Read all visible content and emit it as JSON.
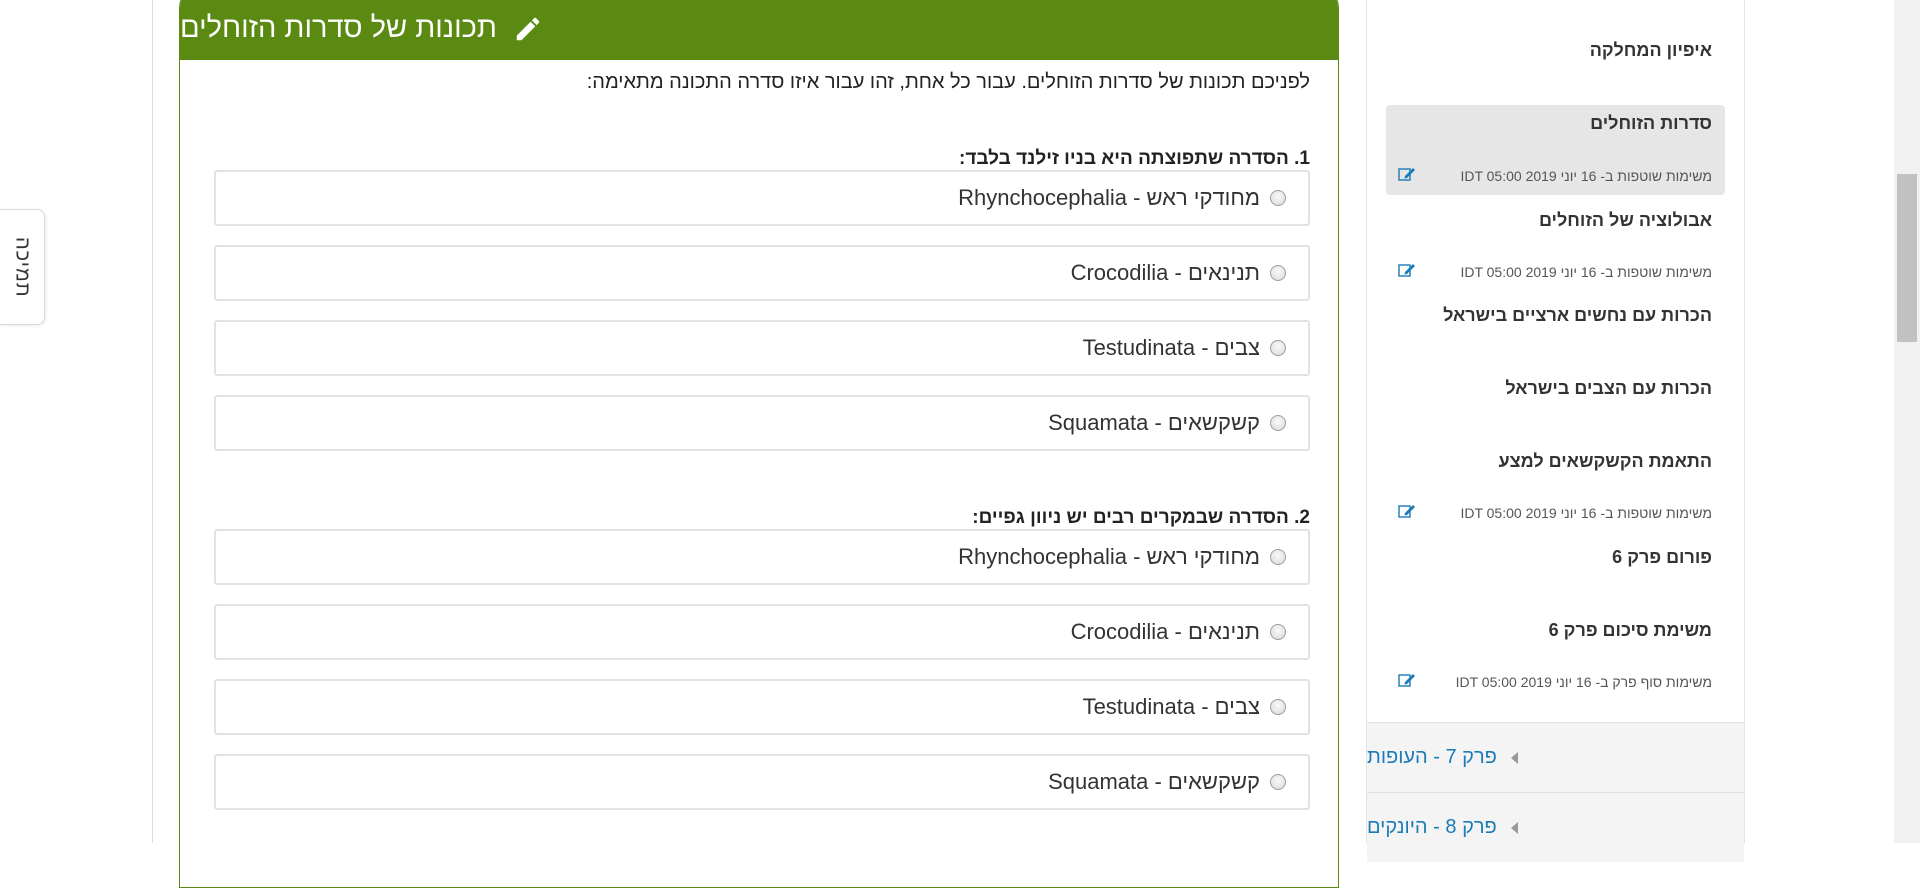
{
  "support_tab": {
    "label": "תמיכה"
  },
  "card": {
    "title": "תכונות של סדרות הזוחלים",
    "header_color": "#5b8a12",
    "intro": "לפניכם תכונות של סדרות הזוחלים. עבור כל אחת, זהו עבור איזו סדרה התכונה מתאימה:",
    "questions": [
      {
        "title": "1. הסדרה שתפוצתה היא בניו זילנד בלבד:",
        "options": [
          "מחודקי ראש - Rhynchocephalia",
          "תנינאים - Crocodilia",
          "צבים - Testudinata",
          "קשקשאים - Squamata"
        ]
      },
      {
        "title": "2. הסדרה שבמקרים רבים יש ניוון גפיים:",
        "options": [
          "מחודקי ראש - Rhynchocephalia",
          "תנינאים - Crocodilia",
          "צבים - Testudinata",
          "קשקשאים - Squamata"
        ]
      }
    ]
  },
  "sidebar": {
    "items": [
      {
        "title": "איפיון המחלקה",
        "meta": ""
      },
      {
        "title": "סדרות הזוחלים",
        "meta": "משימות שוטפות ב- 16 יוני 2019 IDT 05:00",
        "active": true
      },
      {
        "title": "אבולוציה של הזוחלים",
        "meta": "משימות שוטפות ב- 16 יוני 2019 IDT 05:00"
      },
      {
        "title": "הכרות עם נחשים ארציים בישראל",
        "meta": ""
      },
      {
        "title": "הכרות עם הצבים בישראל",
        "meta": ""
      },
      {
        "title": "התאמת הקשקשאים למצע",
        "meta": "משימות שוטפות ב- 16 יוני 2019 IDT 05:00"
      },
      {
        "title": "פורום פרק 6",
        "meta": ""
      },
      {
        "title": "משימת סיכום פרק 6",
        "meta": "משימות סוף פרק ב- 16 יוני 2019 IDT 05:00"
      }
    ],
    "sections": [
      {
        "label": "פרק 7 - העופות"
      },
      {
        "label": "פרק 8 - היונקים"
      }
    ],
    "link_color": "#1b7bb8"
  }
}
